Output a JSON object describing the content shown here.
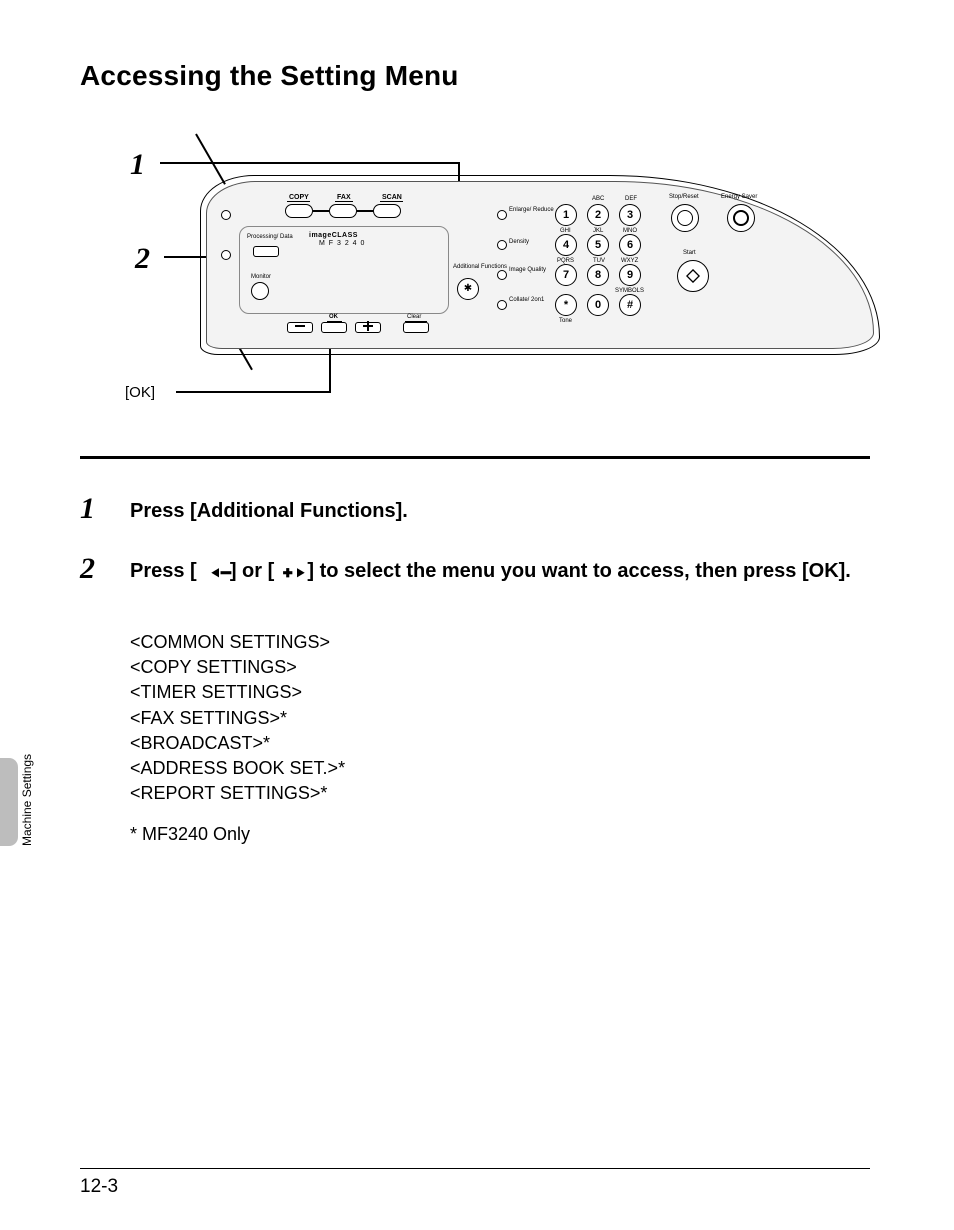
{
  "title": "Accessing the Setting Menu",
  "side_label": "Machine Settings",
  "page_num": "12-3",
  "diagram": {
    "callout1": "1",
    "callout2": "2",
    "ok_label": "[OK]",
    "panel": {
      "copy": "COPY",
      "fax": "FAX",
      "scan": "SCAN",
      "brand": "imageCLASS",
      "model": "M F 3 2 4 0",
      "procdata": "Processing/\nData",
      "monitor": "Monitor",
      "ok": "OK",
      "clear": "Clear",
      "addfunc": "Additional\nFunctions",
      "enlarge": "Enlarge/\nReduce",
      "density": "Density",
      "imgq": "Image\nQuality",
      "collate": "Collate/\n2on1",
      "stopreset": "Stop/Reset",
      "energy": "Energy Saver",
      "start": "Start",
      "tone": "Tone",
      "abc": "ABC",
      "def": "DEF",
      "ghi": "GHI",
      "jkl": "JKL",
      "mno": "MNO",
      "pqrs": "PQRS",
      "tuv": "TUV",
      "wxyz": "WXYZ",
      "symbols": "SYMBOLS",
      "k1": "1",
      "k2": "2",
      "k3": "3",
      "k4": "4",
      "k5": "5",
      "k6": "6",
      "k7": "7",
      "k8": "8",
      "k9": "9",
      "k0": "0",
      "kstar": "*",
      "khash": "#"
    }
  },
  "steps": [
    {
      "num": "1",
      "head": "Press [Additional Functions]."
    },
    {
      "num": "2",
      "head_parts": [
        "Press [",
        "] or [",
        "] to select the menu you want to access, then press [OK]."
      ],
      "menu_items": [
        "<COMMON SETTINGS>",
        "<COPY SETTINGS>",
        "<TIMER SETTINGS>",
        "<FAX SETTINGS>*",
        "<BROADCAST>*",
        "<ADDRESS BOOK SET.>*",
        "<REPORT SETTINGS>*"
      ],
      "footnote": "* MF3240 Only"
    }
  ]
}
